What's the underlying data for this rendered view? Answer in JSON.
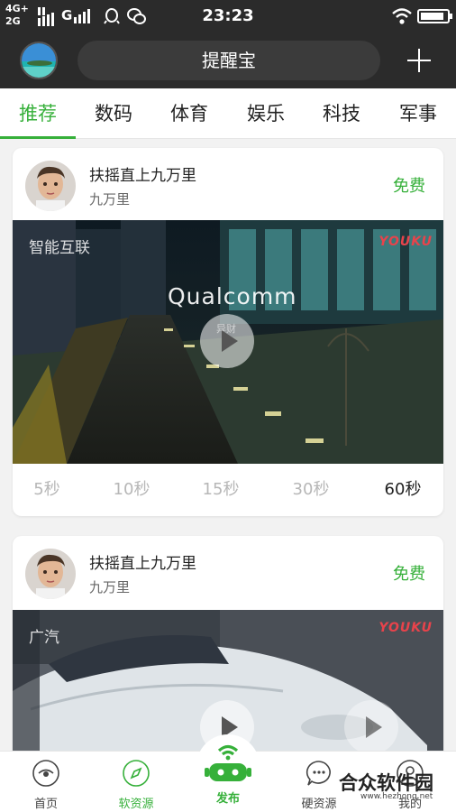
{
  "status_bar": {
    "network_top": "4G+",
    "network_bottom": "2G",
    "carrier2": "G",
    "time": "23:23",
    "battery_level": 0.9
  },
  "header": {
    "title": "提醒宝",
    "add_icon": "plus-icon"
  },
  "tabs": [
    {
      "label": "推荐",
      "active": true
    },
    {
      "label": "数码",
      "active": false
    },
    {
      "label": "体育",
      "active": false
    },
    {
      "label": "娱乐",
      "active": false
    },
    {
      "label": "科技",
      "active": false
    },
    {
      "label": "军事",
      "active": false
    }
  ],
  "cards": [
    {
      "title": "扶摇直上九万里",
      "author": "九万里",
      "badge": "免费",
      "video_tag": "智能互联",
      "brand": "Qualcomm",
      "brand_sub": "异财",
      "logo": "YOUKU",
      "durations": [
        "5秒",
        "10秒",
        "15秒",
        "30秒",
        "60秒"
      ],
      "selected_duration": "60秒"
    },
    {
      "title": "扶摇直上九万里",
      "author": "九万里",
      "badge": "免费",
      "video_tag": "广汽",
      "logo": "YOUKU"
    }
  ],
  "bottom_nav": [
    {
      "label": "首页",
      "icon": "eye-icon"
    },
    {
      "label": "软资源",
      "icon": "compass-icon"
    },
    {
      "label": "发布",
      "icon": "robot-wifi-icon"
    },
    {
      "label": "硬资源",
      "icon": "chat-bubble-icon"
    },
    {
      "label": "我的",
      "icon": "person-icon"
    }
  ],
  "watermark": {
    "text": "合众软件园",
    "url": "www.hezhong.net"
  },
  "colors": {
    "accent": "#36b03a",
    "header_bg": "#2b2b2b"
  }
}
